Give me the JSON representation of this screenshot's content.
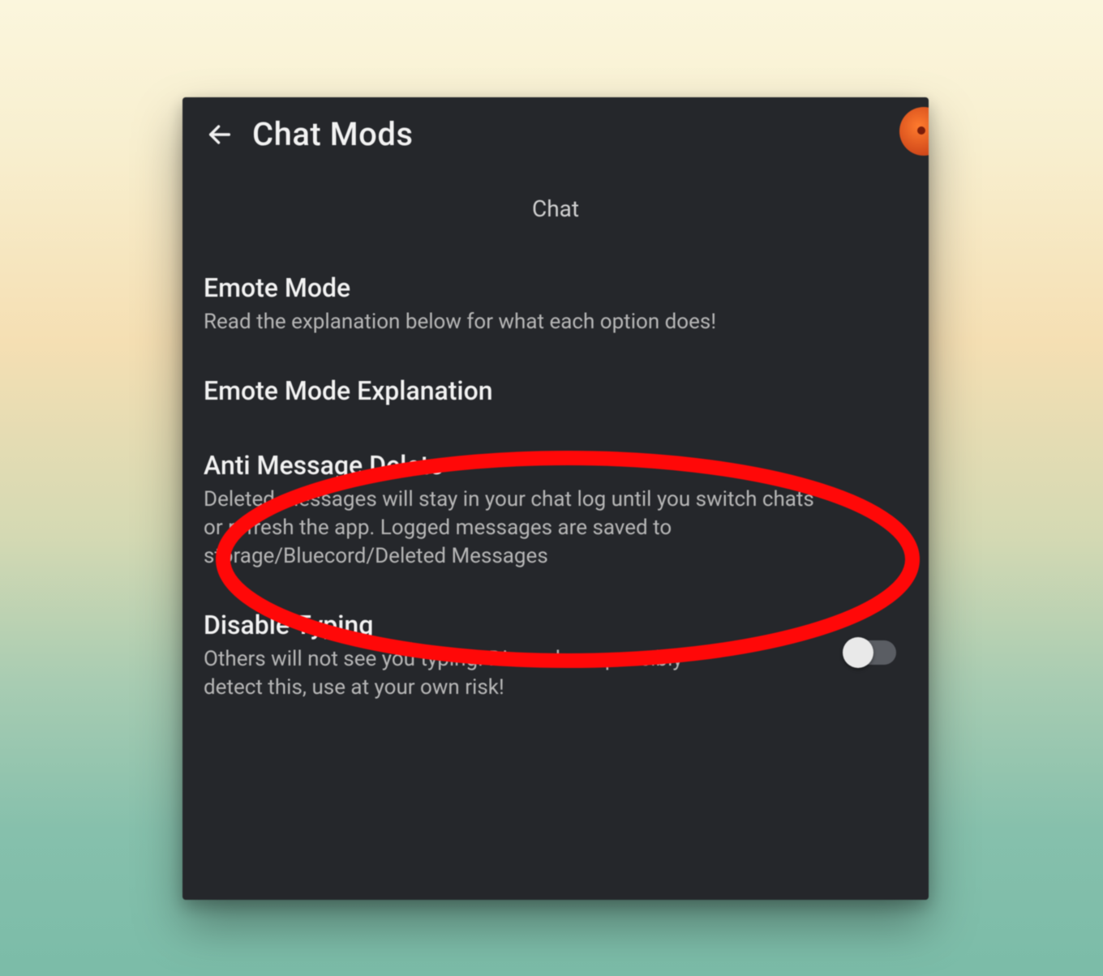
{
  "header": {
    "title": "Chat Mods"
  },
  "section_label": "Chat",
  "settings": {
    "emote_mode": {
      "title": "Emote Mode",
      "desc": "Read the explanation below for what each option does!"
    },
    "emote_mode_explanation": {
      "title": "Emote Mode Explanation"
    },
    "anti_message_delete": {
      "title": "Anti Message Delete",
      "desc": "Deleted messages will stay in your chat log until you switch chats or refresh the app. Logged messages are saved to storage/Bluecord/Deleted Messages"
    },
    "disable_typing": {
      "title": "Disable Typing",
      "desc": "Others will not see you typing. Discord can possibly detect this, use at your own risk!",
      "toggle_on": false
    }
  },
  "annotation": {
    "type": "ellipse",
    "color": "#ff0000"
  }
}
